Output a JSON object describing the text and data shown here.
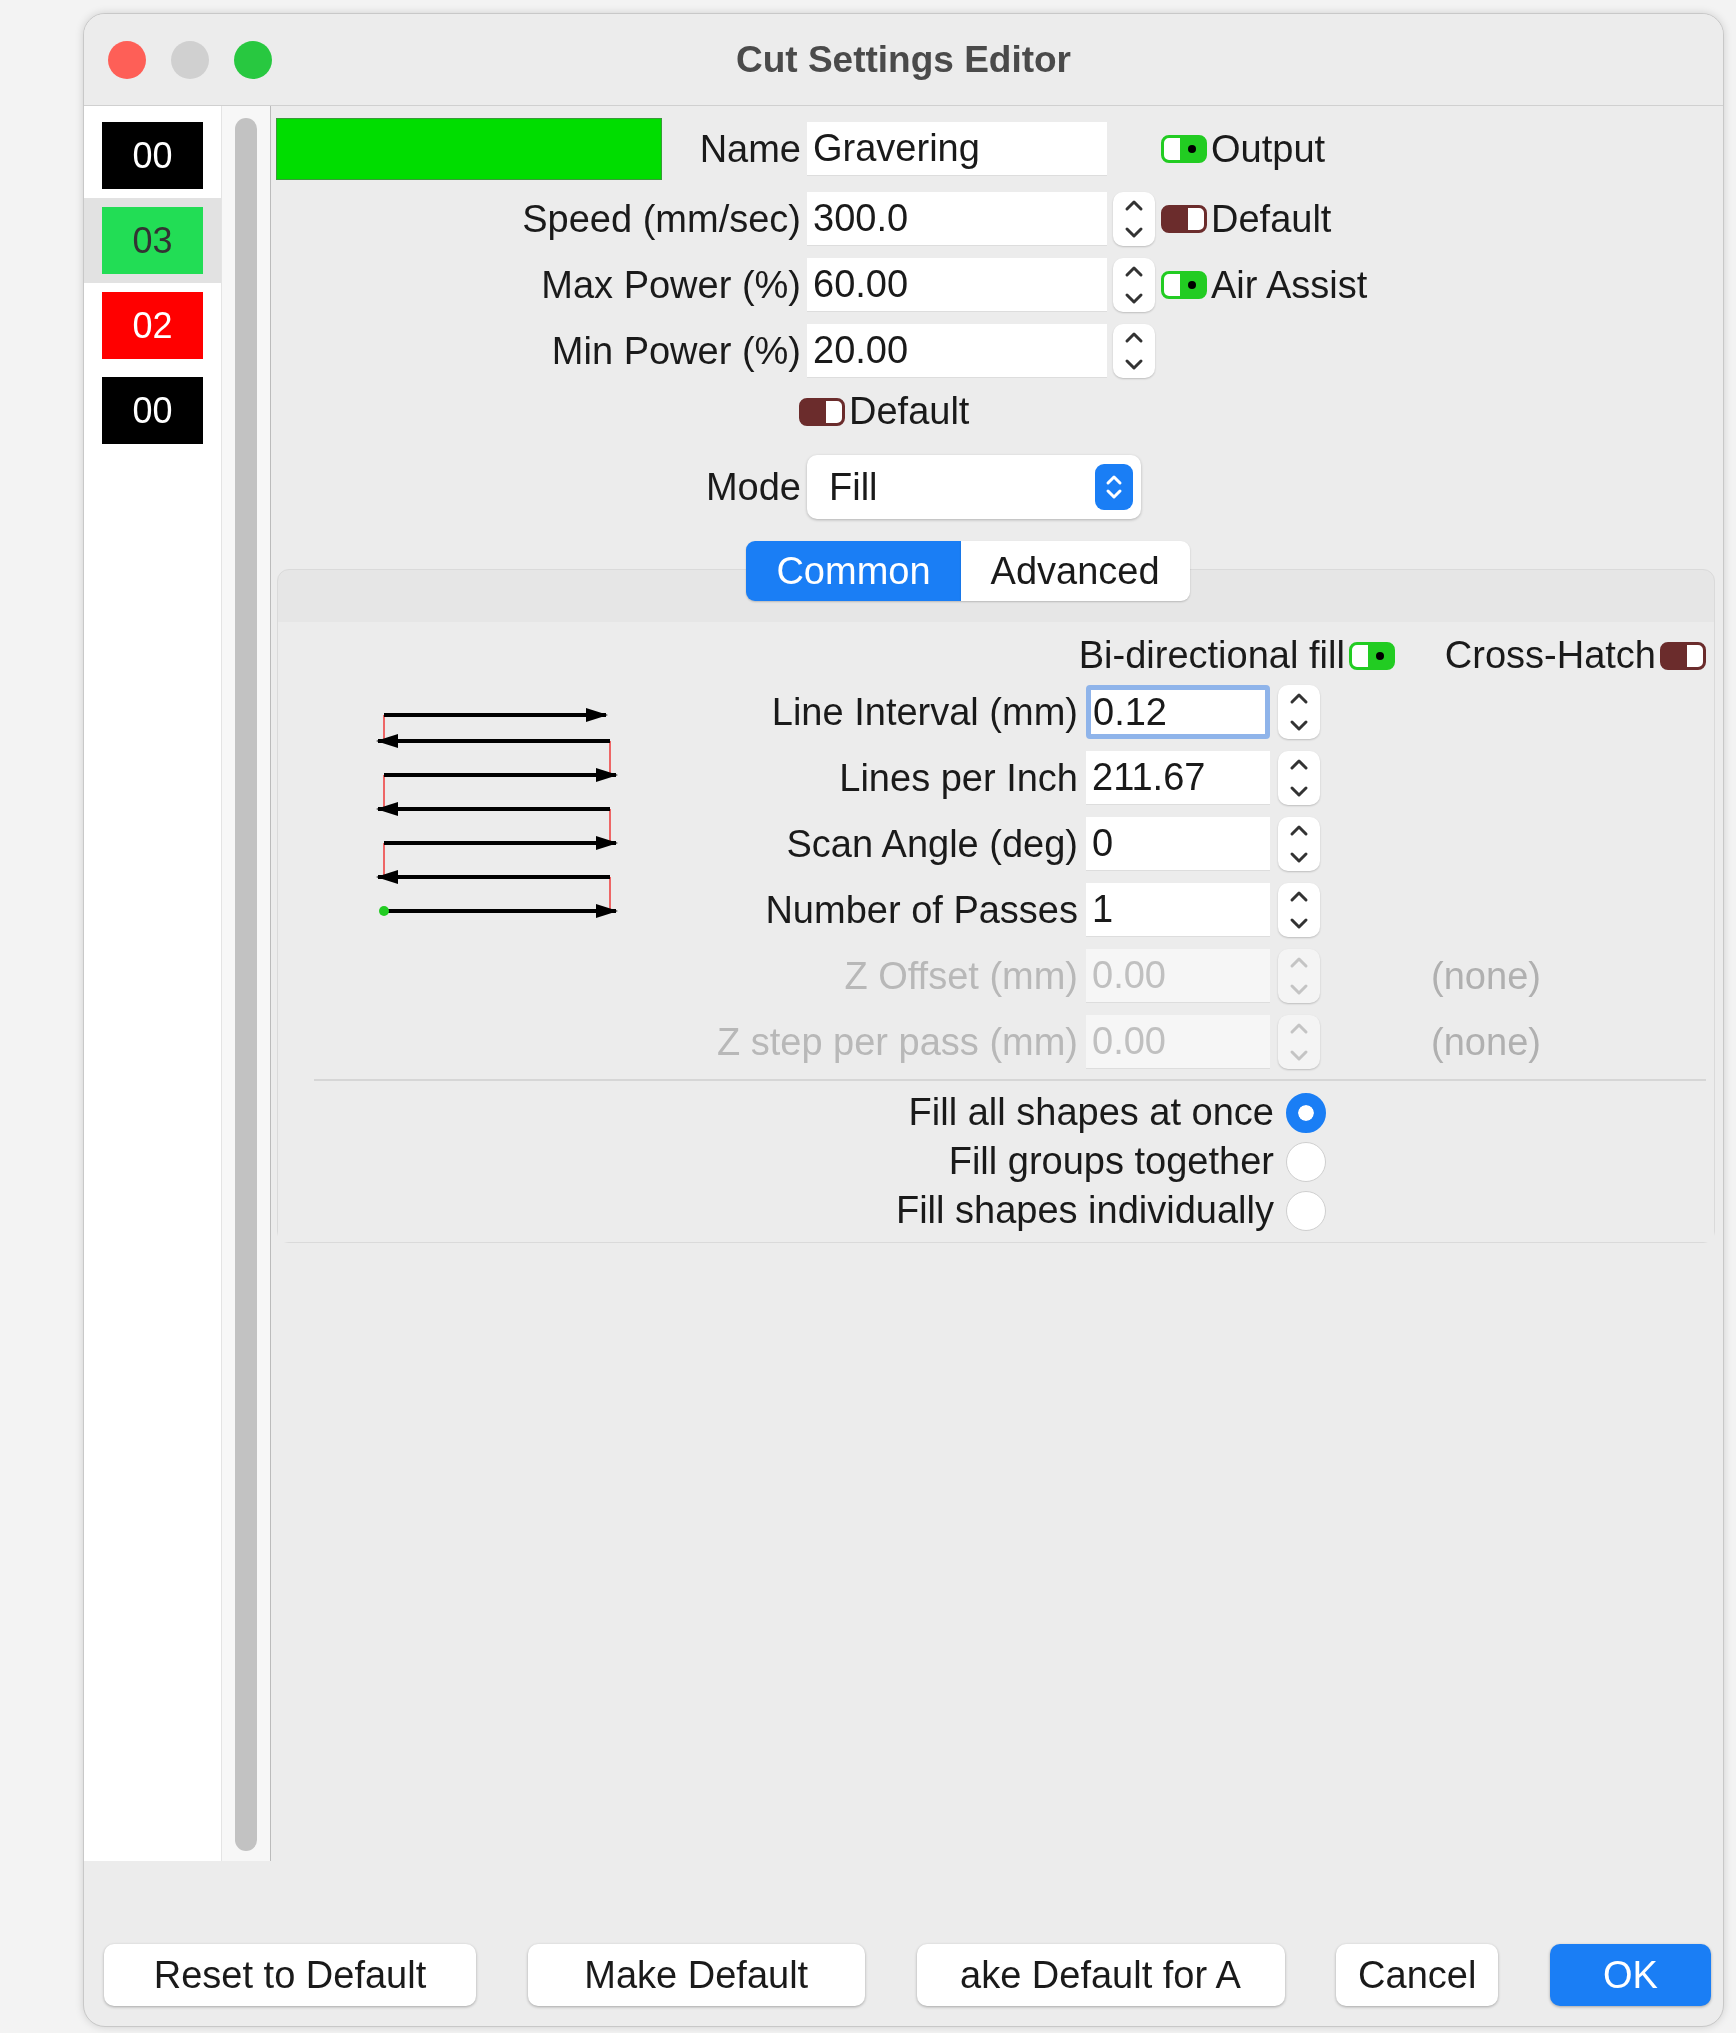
{
  "window": {
    "title": "Cut Settings Editor"
  },
  "layers": [
    {
      "label": "00",
      "color": "#000000",
      "selected": false
    },
    {
      "label": "03",
      "color": "#22dd55",
      "selected": true
    },
    {
      "label": "02",
      "color": "#ff0000",
      "selected": false
    },
    {
      "label": "00",
      "color": "#000000",
      "selected": false
    }
  ],
  "swatch": {
    "color": "#00dd00"
  },
  "name": {
    "label": "Name",
    "value": "Gravering",
    "toggle": {
      "label": "Output",
      "on": true
    }
  },
  "fields": [
    {
      "label": "Speed (mm/sec)",
      "value": "300.0",
      "toggle": {
        "label": "Default",
        "on": false
      }
    },
    {
      "label": "Max Power (%)",
      "value": "60.00",
      "toggle": {
        "label": "Air Assist",
        "on": true
      }
    },
    {
      "label": "Min Power (%)",
      "value": "20.00"
    }
  ],
  "power_default": {
    "label": "Default",
    "on": false
  },
  "mode": {
    "label": "Mode",
    "value": "Fill"
  },
  "tabs": [
    {
      "label": "Common",
      "selected": true
    },
    {
      "label": "Advanced",
      "selected": false
    }
  ],
  "fill_toggles": [
    {
      "label": "Bi-directional fill",
      "on": true
    },
    {
      "label": "Cross-Hatch",
      "on": false
    }
  ],
  "fill_fields": [
    {
      "label": "Line Interval (mm)",
      "value": "0.12",
      "focused": true,
      "disabled": false
    },
    {
      "label": "Lines per Inch",
      "value": "211.67",
      "focused": false,
      "disabled": false
    },
    {
      "label": "Scan Angle (deg)",
      "value": "0",
      "focused": false,
      "disabled": false
    },
    {
      "label": "Number of Passes",
      "value": "1",
      "focused": false,
      "disabled": false
    },
    {
      "label": "Z Offset (mm)",
      "value": "0.00",
      "focused": false,
      "disabled": true,
      "note": "(none)"
    },
    {
      "label": "Z step per pass (mm)",
      "value": "0.00",
      "focused": false,
      "disabled": true,
      "note": "(none)"
    }
  ],
  "fill_order": [
    {
      "label": "Fill all shapes at once",
      "selected": true
    },
    {
      "label": "Fill groups together",
      "selected": false
    },
    {
      "label": "Fill shapes individually",
      "selected": false
    }
  ],
  "buttons": [
    {
      "label": "Reset to Default",
      "kind": "normal"
    },
    {
      "label": "Make Default",
      "kind": "normal"
    },
    {
      "label": "ake Default for A",
      "kind": "normal"
    },
    {
      "label": "Cancel",
      "kind": "normal"
    },
    {
      "label": "OK",
      "kind": "default"
    }
  ]
}
